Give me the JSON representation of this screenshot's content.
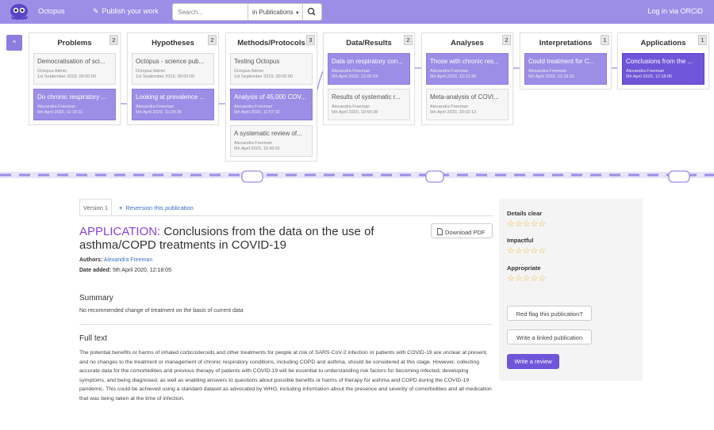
{
  "header": {
    "brand": "Octopus",
    "publish_label": "Publish your work",
    "search_placeholder": "Search...",
    "search_scope": "in Publications",
    "login_label": "Log in via ORCiD"
  },
  "colors": {
    "header_bg": "#9c8ee6",
    "selected_card": "#9c8ee6",
    "current_card": "#6f56d9",
    "kind_label": "#8a3fe0",
    "link": "#3a6fc4",
    "star": "#f0b429"
  },
  "icons": {
    "logo": "octopus-logo-icon",
    "publish": "pen-icon",
    "search": "search-icon",
    "collapse": "chevron-up-icon",
    "download": "document-icon",
    "add": "plus-icon",
    "star": "star-outline-icon"
  },
  "pipeline": {
    "collapse_label": "^",
    "columns": [
      {
        "name": "Problems",
        "count": "2",
        "cards": [
          {
            "title": "Democratisation of sci...",
            "author": "Octopus Admin",
            "date": "1st September 2019, 00:00:00",
            "state": "normal"
          },
          {
            "title": "Do chronic respiratory ...",
            "author": "Alexandra Freeman",
            "date": "5th April 2020, 11:16:11",
            "state": "selected"
          }
        ]
      },
      {
        "name": "Hypotheses",
        "count": "2",
        "cards": [
          {
            "title": "Octopus - science pub...",
            "author": "Octopus Admin",
            "date": "1st September 2019, 00:00:00",
            "state": "normal"
          },
          {
            "title": "Looking at prevalence ...",
            "author": "Alexandra Freeman",
            "date": "5th April 2020, 11:29:30",
            "state": "selected"
          }
        ]
      },
      {
        "name": "Methods/Protocols",
        "count": "3",
        "cards": [
          {
            "title": "Testing Octopus",
            "author": "Octopus Admin",
            "date": "1st September 2019, 00:00:00",
            "state": "normal"
          },
          {
            "title": "Analysis of 45,000 COV...",
            "author": "Alexandra Freeman",
            "date": "5th April 2020, 11:57:32",
            "state": "selected"
          },
          {
            "title": "A systematic review of...",
            "author": "Alexandra Freeman",
            "date": "5th April 2020, 19:49:01",
            "state": "normal"
          }
        ]
      },
      {
        "name": "Data/Results",
        "count": "2",
        "cards": [
          {
            "title": "Data on respiratory con...",
            "author": "Alexandra Freeman",
            "date": "5th April 2020, 12:05:24",
            "state": "selected"
          },
          {
            "title": "Results of systematic r...",
            "author": "Alexandra Freeman",
            "date": "5th April 2020, 19:59:28",
            "state": "normal"
          }
        ]
      },
      {
        "name": "Analyses",
        "count": "2",
        "cards": [
          {
            "title": "Those with chronic res...",
            "author": "Alexandra Freeman",
            "date": "5th April 2020, 12:13:36",
            "state": "selected"
          },
          {
            "title": "Meta-analysis of COVI...",
            "author": "Alexandra Freeman",
            "date": "5th April 2020, 20:02:13",
            "state": "normal"
          }
        ]
      },
      {
        "name": "Interpretations",
        "count": "1",
        "cards": [
          {
            "title": "Could treatment for C...",
            "author": "Alexandra Freeman",
            "date": "5th April 2020, 12:16:15",
            "state": "selected"
          }
        ]
      },
      {
        "name": "Applications",
        "count": "1",
        "cards": [
          {
            "title": "Conclusions from the ...",
            "author": "Alexandra Freeman",
            "date": "5th April 2020, 12:18:05",
            "state": "current"
          }
        ]
      }
    ]
  },
  "publication": {
    "version_tab": "Version 1",
    "reversion_label": "Reversion this publication",
    "kind": "APPLICATION:",
    "title": "Conclusions from the data on the use of asthma/COPD treatments in COVID-19",
    "download_label": "Download PDF",
    "authors_label": "Authors:",
    "authors_value": "Alexandra Freeman",
    "date_label": "Date added:",
    "date_value": "5th April 2020, 12:18:05",
    "summary_heading": "Summary",
    "summary_text": "No recommended change of treatment on the basis of current data",
    "full_text_heading": "Full text",
    "full_text": "The potential benefits or harms of inhaled corticosteroids and other treatments for people at risk of SARS-CoV-2 infection or patients with COVID-19 are unclear at present, and no changes to the treatment or management of chronic respiratory conditions, including COPD and asthma, should be considered at this stage. However, collecting accurate data for the comorbidities and previous therapy of patients with COVID-19 will be essential to understanding risk factors for becoming infected, developing symptoms, and being diagnosed, as well as enabling answers to questions about possible benefits or harms of therapy for asthma and COPD during the COVID-19 pandemic. This could be achieved using a standard dataset as advocated by WHO, including information about the presence and severity of comorbidities and all medication that was being taken at the time of infection."
  },
  "ratings": {
    "details_label": "Details clear",
    "details_stars": 0,
    "impactful_label": "Impactful",
    "impactful_stars": 0,
    "appropriate_label": "Appropriate",
    "appropriate_stars": 0,
    "max_stars": 5,
    "red_flag_label": "Red flag this publication?",
    "linked_label": "Write a linked publication",
    "review_label": "Write a review"
  }
}
